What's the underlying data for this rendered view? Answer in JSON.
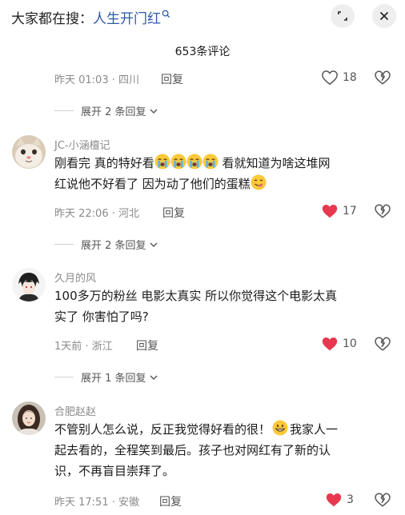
{
  "header": {
    "prefix": "大家都在搜：",
    "keyword": "人生开门红",
    "comment_count": "653条评论"
  },
  "colors": {
    "liked": "#e8384f",
    "link": "#2f5aa8"
  },
  "comments": [
    {
      "meta": "昨天 01:03 · 四川",
      "reply": "回复",
      "likes": "18",
      "liked": false,
      "expand": "展开 2 条回复"
    },
    {
      "user": "JC-小涵檀记",
      "text_a": "刚看完 真的特好看",
      "text_b": " 看就知道为啥这堆网",
      "text_c": "红说他不好看了 因为动了他们的蛋糕",
      "emoji": [
        "loudly-crying-face",
        "loudly-crying-face",
        "loudly-crying-face",
        "loudly-crying-face",
        "yum-face"
      ],
      "meta": "昨天 22:06 · 河北",
      "reply": "回复",
      "likes": "17",
      "liked": true,
      "expand": "展开 2 条回复"
    },
    {
      "user": "久月的风",
      "text_a": "100多万的粉丝  电影太真实  所以你觉得这个电影太真",
      "text_b": "实了 你害怕了吗?",
      "meta": "1天前 · 浙江",
      "reply": "回复",
      "likes": "10",
      "liked": true,
      "expand": "展开 1 条回复"
    },
    {
      "user": "合肥赵赵",
      "text_a": "不管别人怎么说，反正我觉得好看的很！",
      "text_b": "我家人一",
      "text_c": "起去看的，全程笑到最后。孩子也对网红有了新的认",
      "text_d": "识，不再盲目崇拜了。",
      "emoji": [
        "grinning-face"
      ],
      "meta": "昨天 17:51 · 安徽",
      "reply": "回复",
      "likes": "3",
      "liked": true
    }
  ]
}
